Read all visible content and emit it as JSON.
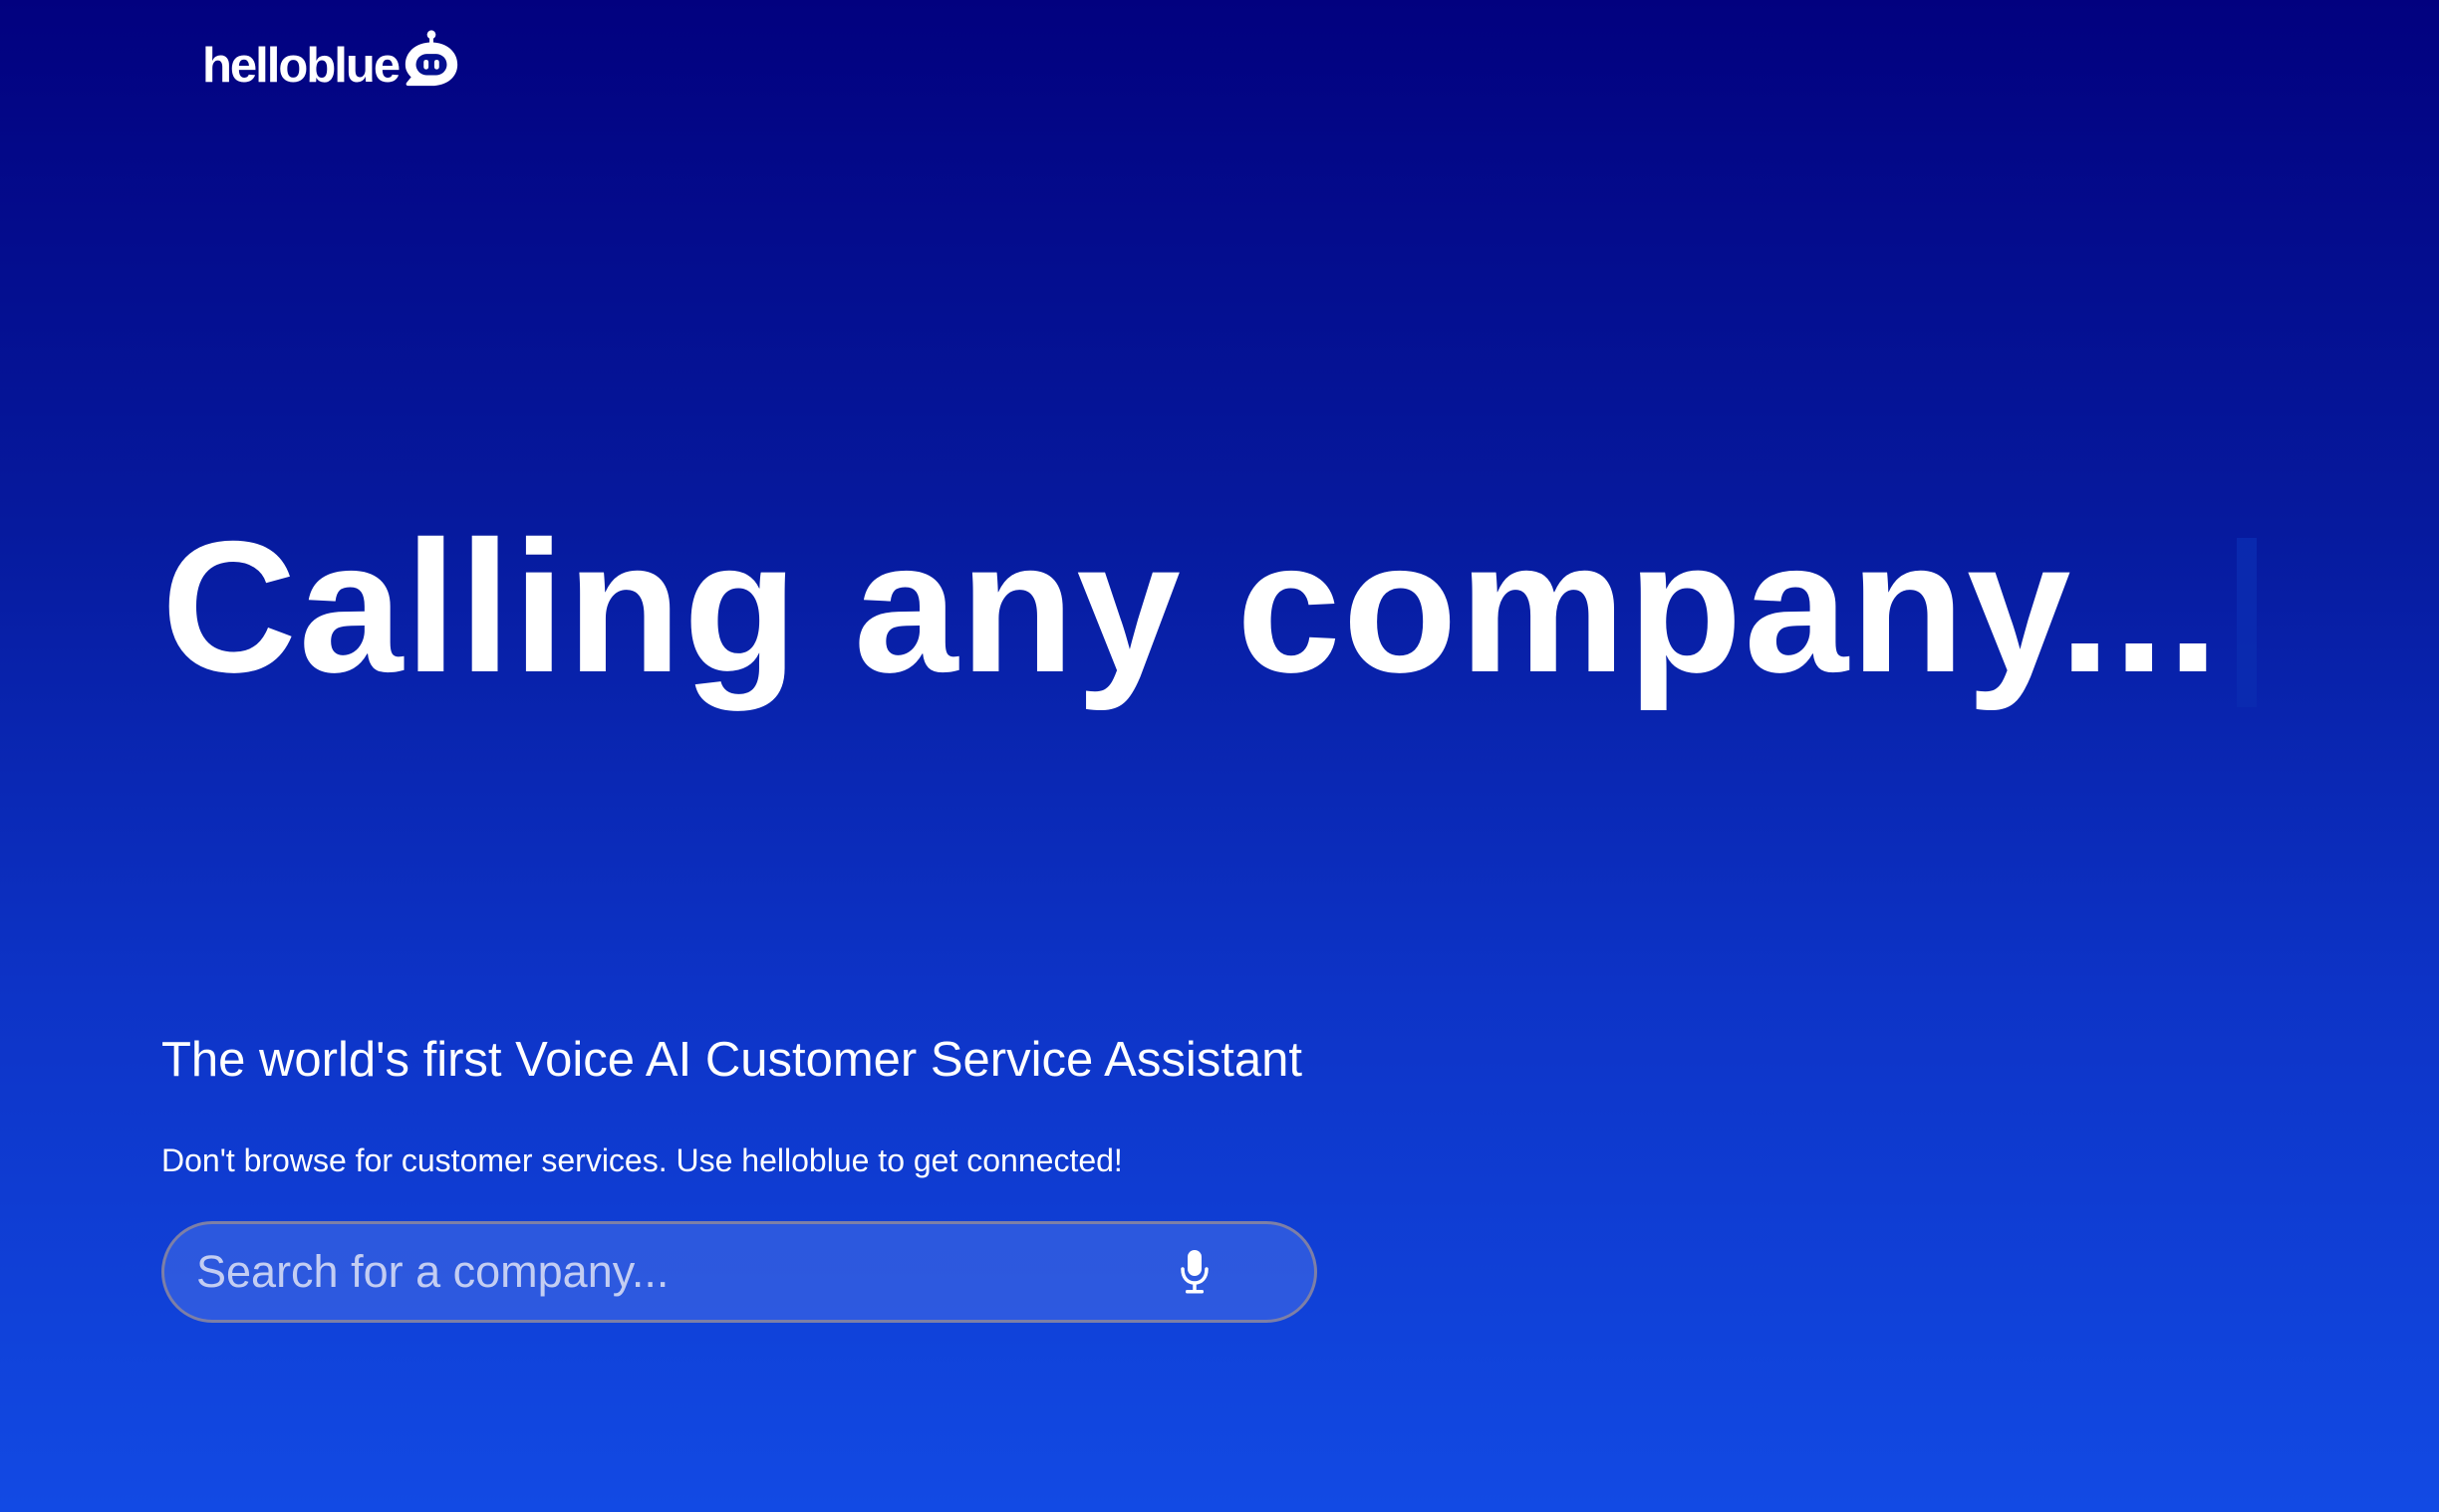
{
  "brand": {
    "name": "helloblue",
    "icon": "robot-chat-icon"
  },
  "hero": {
    "headline": "Calling any company...",
    "tagline": "The world's first Voice AI Customer Service Assistant",
    "subtagline": "Don't browse for customer services. Use helloblue to get connected!"
  },
  "search": {
    "placeholder": "Search for a company...",
    "value": "",
    "mic_icon": "microphone-icon"
  },
  "colors": {
    "gradient_top": "#02017f",
    "gradient_bottom": "#124ae4",
    "text": "#ffffff",
    "search_border": "#7d7fa6"
  }
}
